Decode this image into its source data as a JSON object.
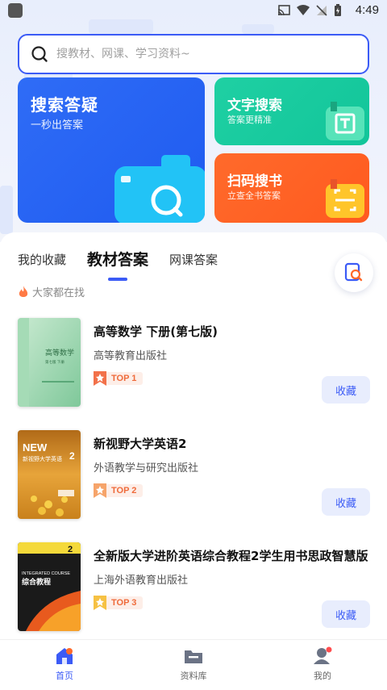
{
  "status_bar": {
    "time": "4:49"
  },
  "search": {
    "placeholder": "搜教材、网课、学习资料~"
  },
  "cards": {
    "search_qa": {
      "title": "搜索答疑",
      "subtitle": "一秒出答案"
    },
    "text_search": {
      "title": "文字搜索",
      "subtitle": "答案更精准"
    },
    "scan_search": {
      "title": "扫码搜书",
      "subtitle": "立查全书答案"
    }
  },
  "tabs": [
    {
      "label": "我的收藏",
      "active": false
    },
    {
      "label": "教材答案",
      "active": true
    },
    {
      "label": "网课答案",
      "active": false
    }
  ],
  "hot": {
    "label": "大家都在找"
  },
  "books": [
    {
      "title": "高等数学 下册(第七版)",
      "publisher": "高等教育出版社",
      "rank": "TOP 1",
      "collect": "收藏"
    },
    {
      "title": "新视野大学英语2",
      "publisher": "外语教学与研究出版社",
      "rank": "TOP 2",
      "collect": "收藏"
    },
    {
      "title": "全新版大学进阶英语综合教程2学生用书思政智慧版",
      "publisher": "上海外语教育出版社",
      "rank": "TOP 3",
      "collect": "收藏"
    }
  ],
  "book_covers": {
    "cover1": {
      "title": "高等数学",
      "subtitle": "第七版 下册"
    },
    "cover2": {
      "title": "NEW",
      "subtitle": "新视野大学英语",
      "num": "2"
    },
    "cover3": {
      "title": "INTEGRATED COURSE",
      "subtitle": "综合教程",
      "num": "2"
    }
  },
  "bottom_nav": [
    {
      "label": "首页",
      "icon": "home-icon",
      "active": true
    },
    {
      "label": "资料库",
      "icon": "folder-icon",
      "active": false
    },
    {
      "label": "我的",
      "icon": "profile-icon",
      "active": false
    }
  ],
  "colors": {
    "accent": "#3b5bf6",
    "green": "#1fd0a3",
    "orange": "#ff6a2b",
    "rank": "#ef6b3b"
  }
}
